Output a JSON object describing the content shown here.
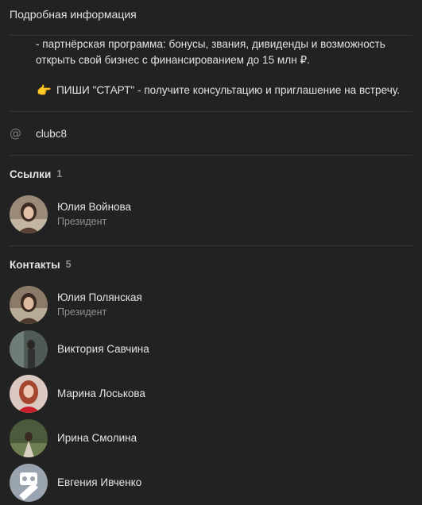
{
  "header": {
    "title": "Подробная информация"
  },
  "description": {
    "line1": "- партнёрская программа: бонусы, звания, дивиденды и возможность",
    "line2": "открыть свой бизнес с финансированием до 15 млн ₽.",
    "cta_emoji": "👉",
    "cta_text": "ПИШИ \"СТАРТ\" - получите консультацию и приглашение на встречу."
  },
  "address": {
    "icon": "@",
    "screen_name": "clubc8"
  },
  "links": {
    "title": "Ссылки",
    "count": "1",
    "items": [
      {
        "name": "Юлия Войнова",
        "role": "Президент"
      }
    ]
  },
  "contacts": {
    "title": "Контакты",
    "count": "5",
    "items": [
      {
        "name": "Юлия Полянская",
        "role": "Президент"
      },
      {
        "name": "Виктория Савчина"
      },
      {
        "name": "Марина Лоськова"
      },
      {
        "name": "Ирина Смолина"
      },
      {
        "name": "Евгения Ивченко"
      }
    ]
  },
  "colors": {
    "background": "#222222",
    "divider": "#363636",
    "text_primary": "#e1e3e6",
    "text_secondary": "#8f8f8f"
  }
}
